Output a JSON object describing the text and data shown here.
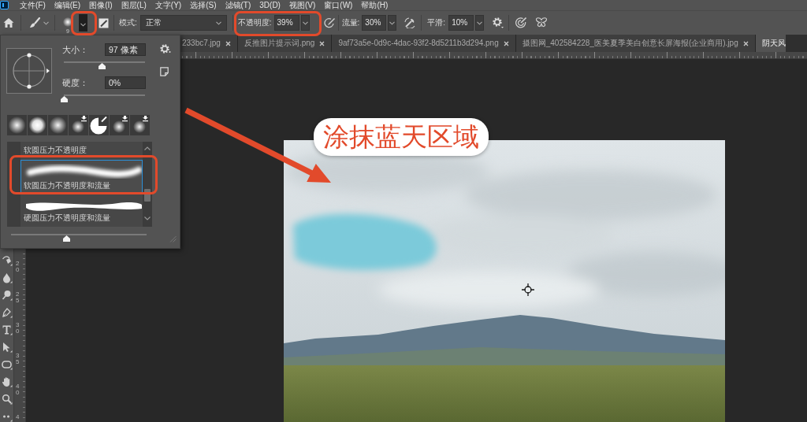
{
  "menu": [
    "文件(F)",
    "编辑(E)",
    "图像(I)",
    "图层(L)",
    "文字(Y)",
    "选择(S)",
    "滤镜(T)",
    "3D(D)",
    "视图(V)",
    "窗口(W)",
    "帮助(H)"
  ],
  "options_bar": {
    "preset_size": "9",
    "mode": {
      "label": "模式:",
      "value": "正常"
    },
    "opacity": {
      "label": "不透明度:",
      "value": "39%"
    },
    "flow": {
      "label": "流量:",
      "value": "30%"
    },
    "smoothing": {
      "label": "平滑:",
      "value": "10%"
    }
  },
  "tabs": [
    {
      "label": "233bc7.jpg",
      "selected": false
    },
    {
      "label": "反推图片提示词.png",
      "selected": false
    },
    {
      "label": "9af73a5e-0d9c-4dac-93f2-8d5211b3d294.png",
      "selected": false
    },
    {
      "label": "摄图网_402584228_医美夏季美白创意长屏海报(企业商用).jpg",
      "selected": false
    },
    {
      "label": "阴天风",
      "selected": true
    }
  ],
  "vertical_ruler": [
    "20",
    "25",
    "30",
    "35",
    "40",
    "4"
  ],
  "brush_panel": {
    "size": {
      "label": "大小：",
      "value": "97 像素",
      "level": 0.47
    },
    "hardness": {
      "label": "硬度：",
      "value": "0%",
      "level": 0
    },
    "tips": [
      {
        "kind": "soft"
      },
      {
        "kind": "bright"
      },
      {
        "kind": "soft"
      },
      {
        "kind": "pressure"
      },
      {
        "kind": "pencil"
      },
      {
        "kind": "pressure"
      },
      {
        "kind": "pressure"
      }
    ],
    "presets": [
      {
        "label": "软圆压力不透明度",
        "selected": false
      },
      {
        "label": "软圆压力不透明度和流量",
        "kind": "soft",
        "selected": true
      },
      {
        "label": "硬圆压力不透明度和流量",
        "kind": "hard",
        "selected": false
      }
    ],
    "preview_slider": {
      "level": 0.41
    }
  },
  "annotation": {
    "label": "涂抹蓝天区域"
  }
}
